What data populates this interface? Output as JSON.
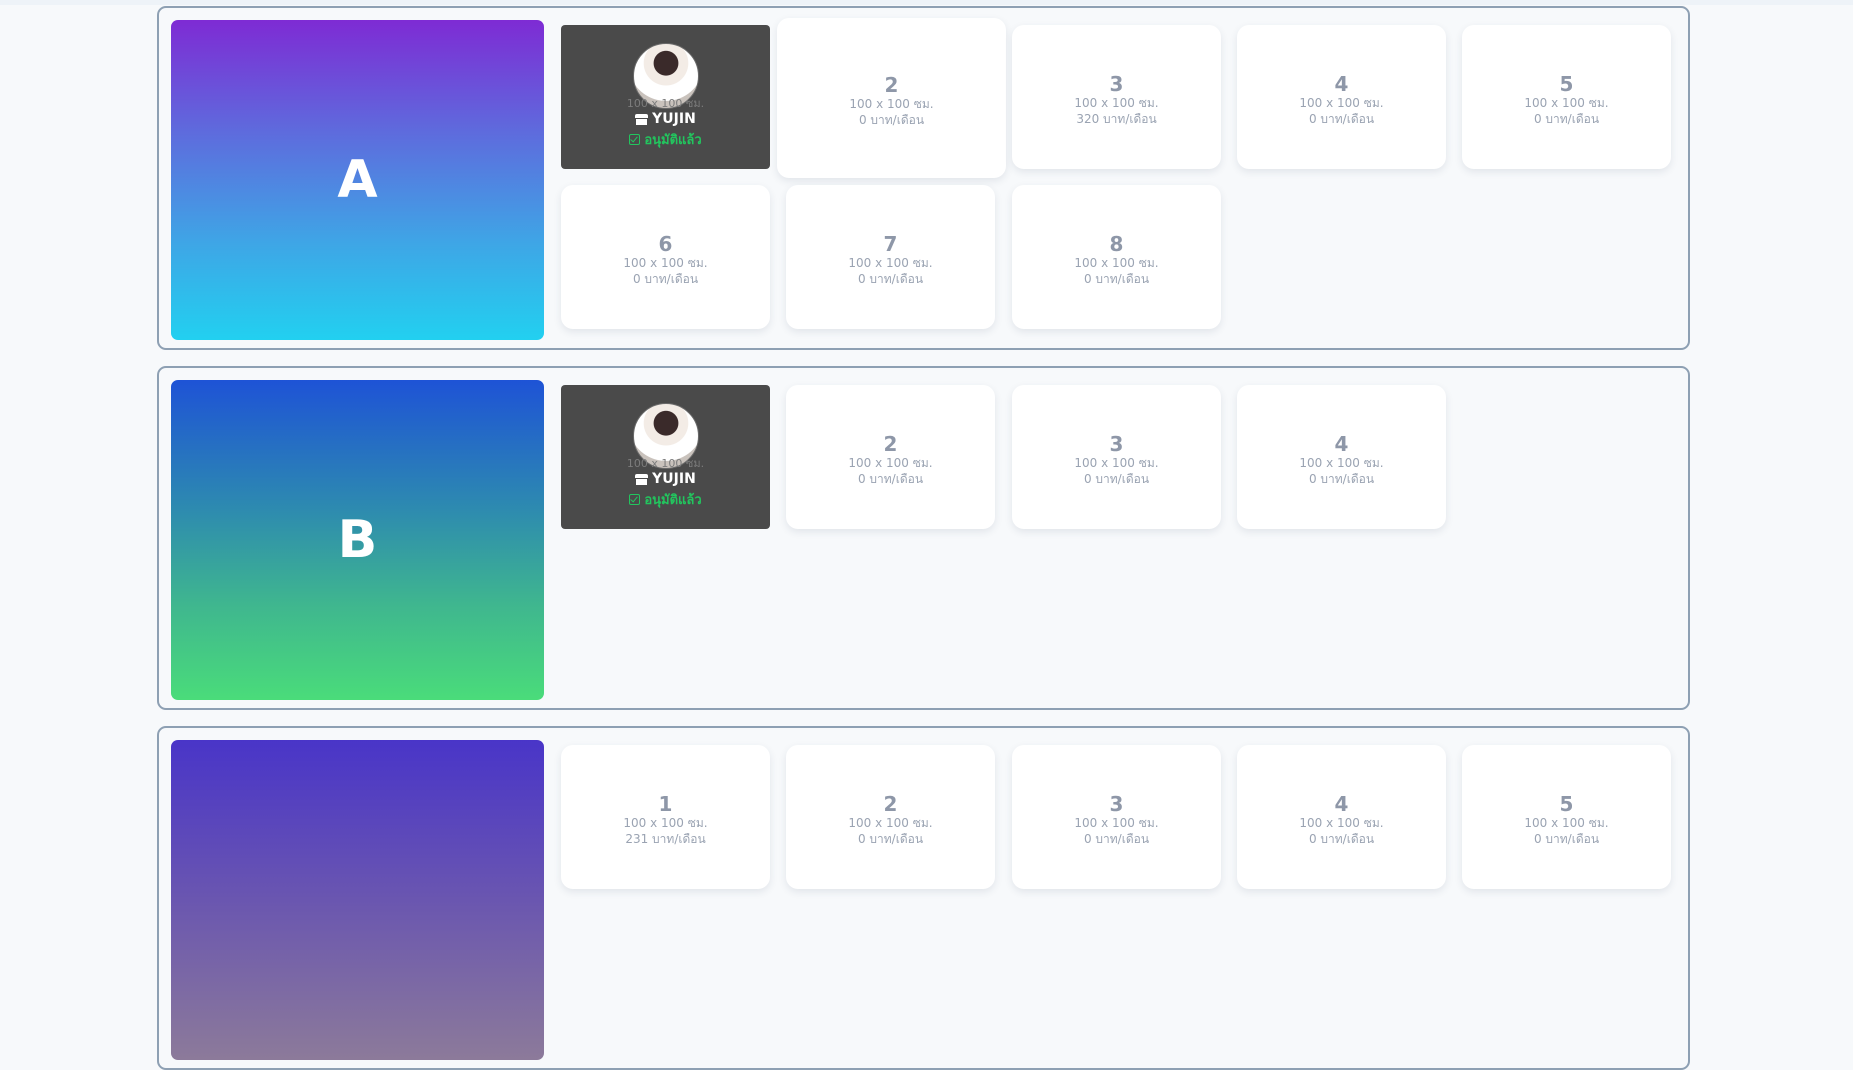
{
  "zones": [
    {
      "label": "A",
      "slots": [
        {
          "num": "1",
          "size": "100 x 100 ซม.",
          "price": "0 บาท/เดือน",
          "taken": true,
          "tenant": "YUJIN",
          "status": "อนุมัติแล้ว"
        },
        {
          "num": "2",
          "size": "100 x 100 ซม.",
          "price": "0 บาท/เดือน"
        },
        {
          "num": "3",
          "size": "100 x 100 ซม.",
          "price": "320 บาท/เดือน"
        },
        {
          "num": "4",
          "size": "100 x 100 ซม.",
          "price": "0 บาท/เดือน"
        },
        {
          "num": "5",
          "size": "100 x 100 ซม.",
          "price": "0 บาท/เดือน"
        },
        {
          "num": "6",
          "size": "100 x 100 ซม.",
          "price": "0 บาท/เดือน"
        },
        {
          "num": "7",
          "size": "100 x 100 ซม.",
          "price": "0 บาท/เดือน"
        },
        {
          "num": "8",
          "size": "100 x 100 ซม.",
          "price": "0 บาท/เดือน"
        }
      ]
    },
    {
      "label": "B",
      "slots": [
        {
          "num": "1",
          "size": "100 x 100 ซม.",
          "price": "0 บาท/เดือน",
          "taken": true,
          "tenant": "YUJIN",
          "status": "อนุมัติแล้ว"
        },
        {
          "num": "2",
          "size": "100 x 100 ซม.",
          "price": "0 บาท/เดือน"
        },
        {
          "num": "3",
          "size": "100 x 100 ซม.",
          "price": "0 บาท/เดือน"
        },
        {
          "num": "4",
          "size": "100 x 100 ซม.",
          "price": "0 บาท/เดือน"
        }
      ]
    },
    {
      "label": "",
      "slots": [
        {
          "num": "1",
          "size": "100 x 100 ซม.",
          "price": "231 บาท/เดือน"
        },
        {
          "num": "2",
          "size": "100 x 100 ซม.",
          "price": "0 บาท/เดือน"
        },
        {
          "num": "3",
          "size": "100 x 100 ซม.",
          "price": "0 บาท/เดือน"
        },
        {
          "num": "4",
          "size": "100 x 100 ซม.",
          "price": "0 บาท/เดือน"
        },
        {
          "num": "5",
          "size": "100 x 100 ซม.",
          "price": "0 บาท/เดือน"
        }
      ]
    }
  ]
}
